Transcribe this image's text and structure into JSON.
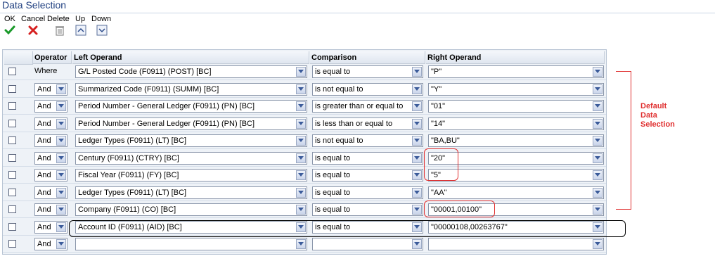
{
  "window": {
    "title": "Data Selection"
  },
  "toolbar": {
    "ok": "OK",
    "cancel": "Cancel",
    "delete": "Delete",
    "up": "Up",
    "down": "Down"
  },
  "grid": {
    "headers": [
      "Operator",
      "Left Operand",
      "Comparison",
      "Right Operand"
    ],
    "rows": [
      {
        "operator": "Where",
        "left": "G/L Posted Code (F0911) (POST) [BC]",
        "comparison": "is equal to",
        "right": "\"P\""
      },
      {
        "operator": "And",
        "left": "Summarized Code (F0911) (SUMM) [BC]",
        "comparison": "is not equal to",
        "right": "\"Y\""
      },
      {
        "operator": "And",
        "left": "Period Number - General Ledger (F0911) (PN) [BC]",
        "comparison": "is greater than or equal to",
        "right": "\"01\""
      },
      {
        "operator": "And",
        "left": "Period Number - General Ledger (F0911) (PN) [BC]",
        "comparison": "is less than or equal to",
        "right": "\"14\""
      },
      {
        "operator": "And",
        "left": "Ledger Types (F0911) (LT) [BC]",
        "comparison": "is not equal to",
        "right": "\"BA,BU\""
      },
      {
        "operator": "And",
        "left": "Century (F0911) (CTRY) [BC]",
        "comparison": "is equal to",
        "right": "\"20\""
      },
      {
        "operator": "And",
        "left": "Fiscal Year (F0911) (FY) [BC]",
        "comparison": "is equal to",
        "right": "\"5\""
      },
      {
        "operator": "And",
        "left": "Ledger Types (F0911) (LT) [BC]",
        "comparison": "is equal to",
        "right": "\"AA\""
      },
      {
        "operator": "And",
        "left": "Company (F0911) (CO) [BC]",
        "comparison": "is equal to",
        "right": "\"00001,00100\""
      },
      {
        "operator": "And",
        "left": "Account ID (F0911) (AID) [BC]",
        "comparison": "is equal to",
        "right": "\"00000108,00263767\""
      },
      {
        "operator": "And",
        "left": "",
        "comparison": "",
        "right": ""
      }
    ]
  },
  "annotation": {
    "text": "Default Data Selection"
  },
  "colors": {
    "title": "#1f3f80",
    "annotation": "#e03030",
    "ok": "#1a9a2a",
    "cancel": "#d62020"
  }
}
